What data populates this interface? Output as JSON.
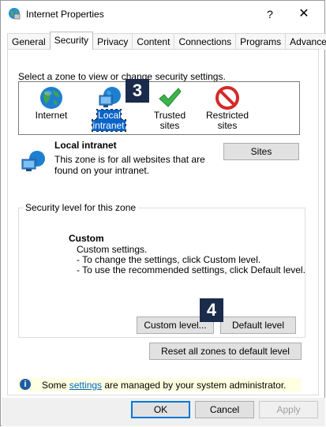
{
  "window": {
    "title": "Internet Properties",
    "help": "?",
    "close": "✕"
  },
  "tabs": [
    {
      "label": "General"
    },
    {
      "label": "Security"
    },
    {
      "label": "Privacy"
    },
    {
      "label": "Content"
    },
    {
      "label": "Connections"
    },
    {
      "label": "Programs"
    },
    {
      "label": "Advanced"
    }
  ],
  "active_tab": "Security",
  "zones": {
    "prompt": "Select a zone to view or change security settings.",
    "items": [
      {
        "label": "Internet",
        "icon": "globe-icon"
      },
      {
        "label": "Local intranet",
        "icon": "network-icon",
        "selected": true
      },
      {
        "label": "Trusted sites",
        "icon": "checkmark-icon"
      },
      {
        "label_line1": "Restricted",
        "label_line2": "sites",
        "icon": "no-entry-icon"
      }
    ]
  },
  "callouts": {
    "three": "3",
    "four": "4"
  },
  "zone_detail": {
    "title": "Local intranet",
    "line1": "This zone is for all websites that are",
    "line2": "found on your intranet.",
    "sites_button": "Sites"
  },
  "security_level": {
    "legend": "Security level for this zone",
    "custom_title": "Custom",
    "line1": "Custom settings.",
    "line2": "- To change the settings, click Custom level.",
    "line3": "- To use the recommended settings, click Default level.",
    "custom_level_button": "Custom level...",
    "default_level_button": "Default level"
  },
  "reset_button": "Reset all zones to default level",
  "info": {
    "prefix": "Some ",
    "link": "settings",
    "suffix": " are managed by your system administrator."
  },
  "footer": {
    "ok": "OK",
    "cancel": "Cancel",
    "apply": "Apply"
  },
  "colors": {
    "selection": "#0a64c8",
    "callout_bg": "#1b2b4b",
    "default_button_border": "#0078d7",
    "info_bar": "#ffffe1"
  }
}
